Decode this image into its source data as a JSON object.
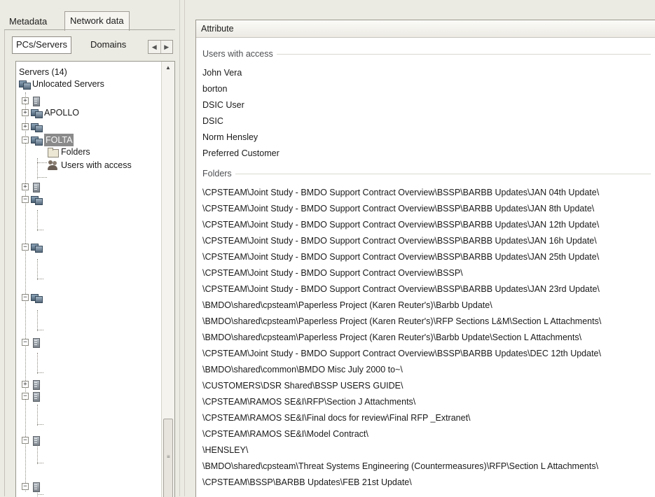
{
  "tabs": {
    "metadata": "Metadata",
    "network_data": "Network data"
  },
  "subtabs": {
    "pcs_servers": "PCs/Servers",
    "domains": "Domains"
  },
  "tree": {
    "root": "Servers (14)",
    "unlocated": "Unlocated Servers",
    "apollo": "APOLLO",
    "selected": "FOLTA",
    "folders": "Folders",
    "users_with_access": "Users with access"
  },
  "attribute_header": "Attribute",
  "users_group": {
    "title": "Users with access",
    "items": [
      "John Vera",
      "borton",
      "DSIC User",
      "DSIC",
      "Norm Hensley",
      "Preferred Customer"
    ]
  },
  "folders_group": {
    "title": "Folders",
    "items": [
      "\\CPSTEAM\\Joint Study - BMDO Support Contract Overview\\BSSP\\BARBB Updates\\JAN 04th Update\\",
      "\\CPSTEAM\\Joint Study - BMDO Support Contract Overview\\BSSP\\BARBB Updates\\JAN 8th Update\\",
      "\\CPSTEAM\\Joint Study - BMDO Support Contract Overview\\BSSP\\BARBB Updates\\JAN 12th Update\\",
      "\\CPSTEAM\\Joint Study - BMDO Support Contract Overview\\BSSP\\BARBB Updates\\JAN 16h Update\\",
      "\\CPSTEAM\\Joint Study - BMDO Support Contract Overview\\BSSP\\BARBB Updates\\JAN 25th Update\\",
      "\\CPSTEAM\\Joint Study - BMDO Support Contract Overview\\BSSP\\",
      "\\CPSTEAM\\Joint Study - BMDO Support Contract Overview\\BSSP\\BARBB Updates\\JAN 23rd Update\\",
      "\\BMDO\\shared\\cpsteam\\Paperless Project (Karen Reuter's)\\Barbb Update\\",
      "\\BMDO\\shared\\cpsteam\\Paperless Project (Karen Reuter's)\\RFP Sections L&M\\Section L Attachments\\",
      "\\BMDO\\shared\\cpsteam\\Paperless Project (Karen Reuter's)\\Barbb Update\\Section L Attachments\\",
      "\\CPSTEAM\\Joint Study - BMDO Support Contract Overview\\BSSP\\BARBB Updates\\DEC 12th Update\\",
      "\\BMDO\\shared\\common\\BMDO Misc July 2000 to~\\",
      "\\CUSTOMERS\\DSR Shared\\BSSP USERS GUIDE\\",
      "\\CPSTEAM\\RAMOS SE&I\\RFP\\Section J Attachments\\",
      "\\CPSTEAM\\RAMOS SE&I\\Final docs for review\\Final RFP _Extranet\\",
      "\\CPSTEAM\\RAMOS SE&I\\Model Contract\\",
      "\\HENSLEY\\",
      "\\BMDO\\shared\\cpsteam\\Threat Systems Engineering (Countermeasures)\\RFP\\Section L Attachments\\",
      "\\CPSTEAM\\BSSP\\BARBB Updates\\FEB 21st Update\\"
    ]
  }
}
